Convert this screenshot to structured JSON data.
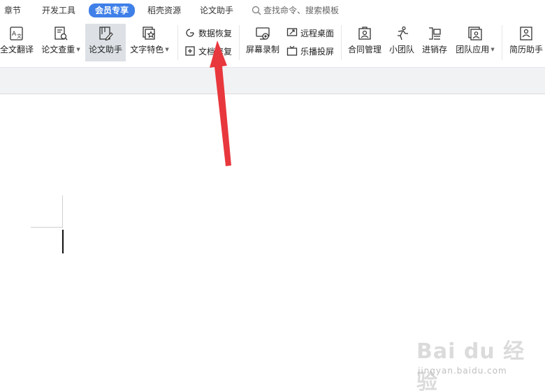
{
  "menu": {
    "tabs": [
      {
        "label": "章节"
      },
      {
        "label": "开发工具"
      },
      {
        "label": "会员专享",
        "active": true
      },
      {
        "label": "稻壳资源"
      },
      {
        "label": "论文助手"
      }
    ],
    "search_placeholder": "查找命令、搜索模板"
  },
  "toolbar": {
    "full_translate": "全文翻译",
    "thesis_check": "论文查重",
    "thesis_assistant": "论文助手",
    "text_effects": "文字特色",
    "data_recovery": "数据恢复",
    "doc_repair": "文档修复",
    "screen_record": "屏幕录制",
    "remote_desktop": "远程桌面",
    "screen_cast": "乐播投屏",
    "contract_manage": "合同管理",
    "small_team": "小团队",
    "inventory": "进销存",
    "team_apps": "团队应用",
    "resume_assistant": "简历助手"
  },
  "colors": {
    "accent": "#3f7fe8",
    "arrow": "#e8383d",
    "selected_bg": "#dde1e6",
    "band_bg": "#f1f2f4"
  },
  "watermark": {
    "logo": "Bai du 经验",
    "url": "jingyan.baidu.com"
  }
}
